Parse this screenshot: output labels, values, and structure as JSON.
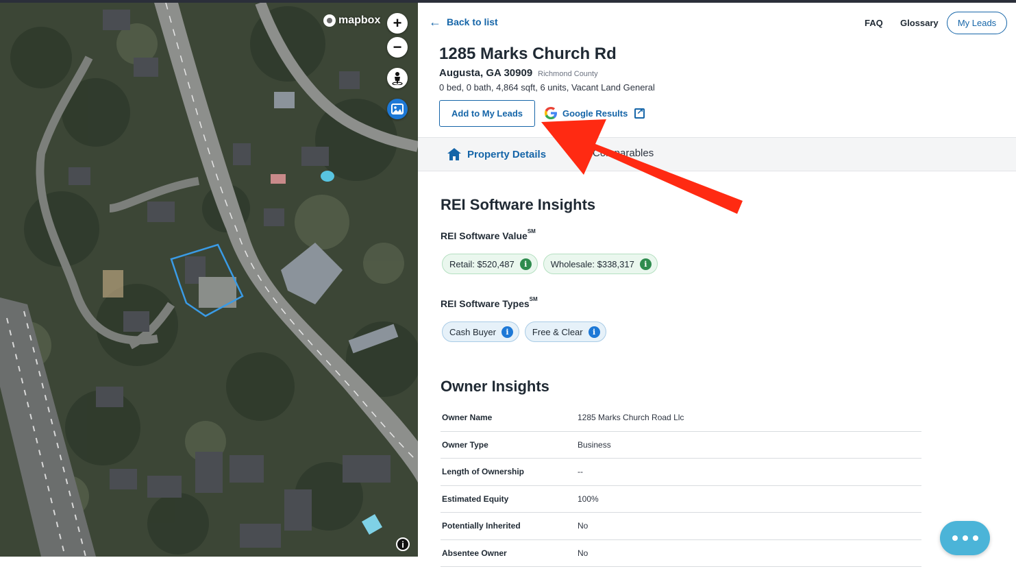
{
  "map": {
    "brand": "mapbox",
    "controls": [
      "+",
      "−"
    ],
    "info_glyph": "i"
  },
  "nav": {
    "back_label": "Back to list",
    "faq": "FAQ",
    "glossary": "Glossary",
    "my_leads": "My Leads"
  },
  "property": {
    "address": "1285 Marks Church Rd",
    "city_state_zip": "Augusta, GA 30909",
    "county": "Richmond County",
    "specs": "0 bed, 0 bath, 4,864 sqft, 6 units, Vacant Land General"
  },
  "actions": {
    "add_to_leads": "Add to My Leads",
    "google_results": "Google Results"
  },
  "tabs": {
    "details": "Property Details",
    "comparables": "Comparables"
  },
  "insights": {
    "title": "REI Software Insights",
    "value_heading": "REI Software Value",
    "value_sup": "SM",
    "value_chips": [
      {
        "label": "Retail: $520,487"
      },
      {
        "label": "Wholesale: $338,317"
      }
    ],
    "types_heading": "REI Software Types",
    "types_sup": "SM",
    "type_chips": [
      {
        "label": "Cash Buyer"
      },
      {
        "label": "Free & Clear"
      }
    ]
  },
  "owner": {
    "title": "Owner Insights",
    "rows": [
      {
        "key": "Owner Name",
        "value": "1285 Marks Church Road Llc"
      },
      {
        "key": "Owner Type",
        "value": "Business"
      },
      {
        "key": "Length of Ownership",
        "value": "--"
      },
      {
        "key": "Estimated Equity",
        "value": "100%"
      },
      {
        "key": "Potentially Inherited",
        "value": "No"
      },
      {
        "key": "Absentee Owner",
        "value": "No"
      }
    ]
  },
  "colors": {
    "accent": "#1565a8",
    "annotation_arrow": "#ff2a12",
    "parcel_outline": "#3a9be6",
    "chat_button": "#4bb4d8"
  }
}
